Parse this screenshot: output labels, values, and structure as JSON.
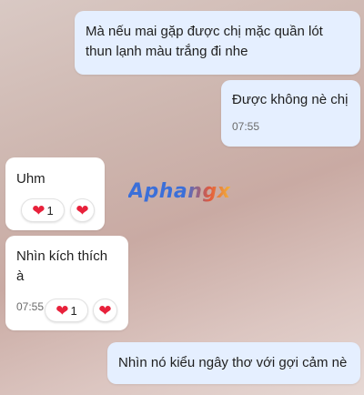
{
  "messages": [
    {
      "text": "Mà nếu mai gặp được chị mặc quần lót thun lạnh màu trắng đi nhe"
    },
    {
      "text": "Được không nè chị",
      "time": "07:55"
    },
    {
      "text": "Uhm",
      "reaction_count": "1"
    },
    {
      "text": "Nhìn kích thích à",
      "time": "07:55",
      "reaction_count": "1"
    },
    {
      "text": "Nhìn nó kiểu ngây thơ với gợi cảm nè"
    }
  ],
  "watermark": "Aphangx",
  "icons": {
    "reaction": "heart-icon",
    "add_reaction": "heart-icon"
  },
  "colors": {
    "outgoing_bubble": "#e5efff",
    "incoming_bubble": "#ffffff",
    "heart": "#e8213b"
  }
}
